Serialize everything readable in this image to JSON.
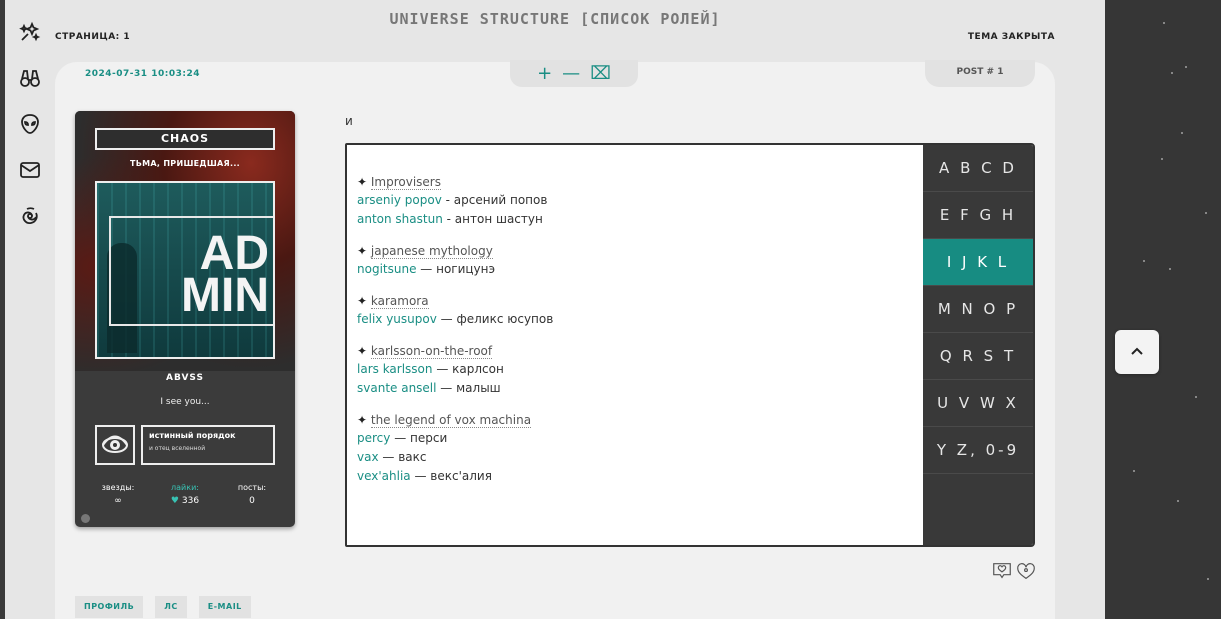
{
  "header": {
    "title": "UNIVERSE STRUCTURE [СПИСОК РОЛЕЙ]",
    "page": "СТРАНИЦА: 1",
    "status": "ТЕМА ЗАКРЫТА"
  },
  "rail": {
    "icons": [
      "sparkles-icon",
      "binoculars-icon",
      "alien-icon",
      "mail-icon",
      "galaxy-icon"
    ]
  },
  "post": {
    "date": "2024-07-31 10:03:24",
    "tools": {
      "plus": "+",
      "minus": "—",
      "clear": "⌧"
    },
    "number": "POST # 1",
    "intro": "и",
    "profile": {
      "name": "CHAOS",
      "title": "ТЬМА, ПРИШЕДШАЯ...",
      "avatar_text_1": "AD",
      "avatar_text_2": "MIN",
      "nick": "ABVSS",
      "quote": "I see you...",
      "badge_title": "истинный порядок",
      "badge_sub": "и отец вселенной",
      "stats": {
        "stars_label": "звезды:",
        "stars_value": "∞",
        "likes_label": "лайки:",
        "likes_value": "336",
        "posts_label": "посты:",
        "posts_value": "0"
      }
    },
    "groups": [
      {
        "fandom": "Improvisers",
        "roles": [
          {
            "en": "arseniy popov",
            "sep": " - ",
            "ru": "арсений попов"
          },
          {
            "en": "anton shastun",
            "sep": " - ",
            "ru": "антон шастун"
          }
        ]
      },
      {
        "fandom": "japanese mythology",
        "roles": [
          {
            "en": "nogitsune",
            "sep": " — ",
            "ru": "ногицунэ"
          }
        ]
      },
      {
        "fandom": "karamora",
        "roles": [
          {
            "en": "felix yusupov",
            "sep": " — ",
            "ru": "феликс юсупов"
          }
        ]
      },
      {
        "fandom": "karlsson-on-the-roof",
        "roles": [
          {
            "en": "lars karlsson",
            "sep": " — ",
            "ru": "карлсон"
          },
          {
            "en": "svante ansell",
            "sep": " — ",
            "ru": "малыш"
          }
        ]
      },
      {
        "fandom": "the legend of vox machina",
        "roles": [
          {
            "en": "percy",
            "sep": " — ",
            "ru": "перси"
          },
          {
            "en": "vax",
            "sep": " — ",
            "ru": "вакс"
          },
          {
            "en": "vex'ahlia",
            "sep": " — ",
            "ru": "векс'алия"
          }
        ]
      }
    ],
    "letters": [
      "A B C D",
      "E F G H",
      "I J K L",
      "M N O P",
      "Q R S T",
      "U V W X",
      "Y Z, 0-9"
    ],
    "active_letter_index": 2,
    "footer_links": [
      "ПРОФИЛЬ",
      "ЛС",
      "E-MAIL"
    ]
  },
  "colors": {
    "accent": "#1a8e84",
    "active_tab": "#178c82",
    "dark_panel": "#393939"
  }
}
